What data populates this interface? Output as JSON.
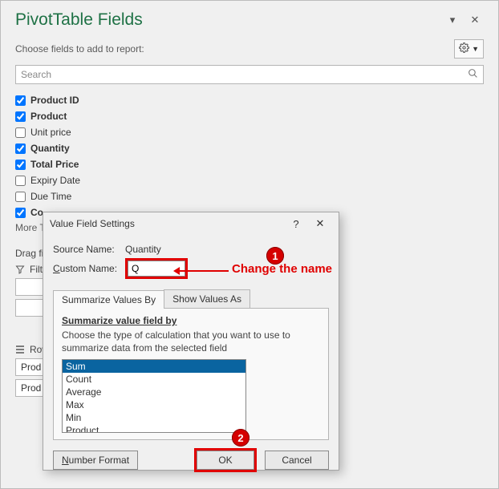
{
  "panel": {
    "title": "PivotTable Fields",
    "subtitle": "Choose fields to add to report:",
    "search_placeholder": "Search",
    "more_tables": "More Tables...",
    "drag_label": "Drag fields between areas below:",
    "fields": [
      {
        "label": "Product ID",
        "checked": true,
        "bold": true
      },
      {
        "label": "Product",
        "checked": true,
        "bold": true
      },
      {
        "label": "Unit price",
        "checked": false,
        "bold": false
      },
      {
        "label": "Quantity",
        "checked": true,
        "bold": true
      },
      {
        "label": "Total Price",
        "checked": true,
        "bold": true
      },
      {
        "label": "Expiry Date",
        "checked": false,
        "bold": false
      },
      {
        "label": "Due Time",
        "checked": false,
        "bold": false
      },
      {
        "label": "Co",
        "checked": true,
        "bold": true
      }
    ],
    "areas": {
      "filters_label": "Filters",
      "rows_label": "Rows",
      "row_items": [
        "Prod",
        "Prod"
      ]
    }
  },
  "dialog": {
    "title": "Value Field Settings",
    "source_label": "Source Name:",
    "source_value": "Quantity",
    "custom_label_pre": "C",
    "custom_label_rest": "ustom Name:",
    "custom_value": "Q",
    "tab1": "Summarize Values By",
    "tab2": "Show Values As",
    "summary_label_pre": "S",
    "summary_label_rest": "ummarize value field by",
    "summary_desc": "Choose the type of calculation that you want to use to summarize data from the selected field",
    "calc_options": [
      "Sum",
      "Count",
      "Average",
      "Max",
      "Min",
      "Product"
    ],
    "selected_calc": "Sum",
    "btn_number_format_pre": "N",
    "btn_number_format_rest": "umber Format",
    "btn_ok": "OK",
    "btn_cancel": "Cancel"
  },
  "annotation": {
    "text": "Change the name",
    "marker1": "1",
    "marker2": "2"
  }
}
